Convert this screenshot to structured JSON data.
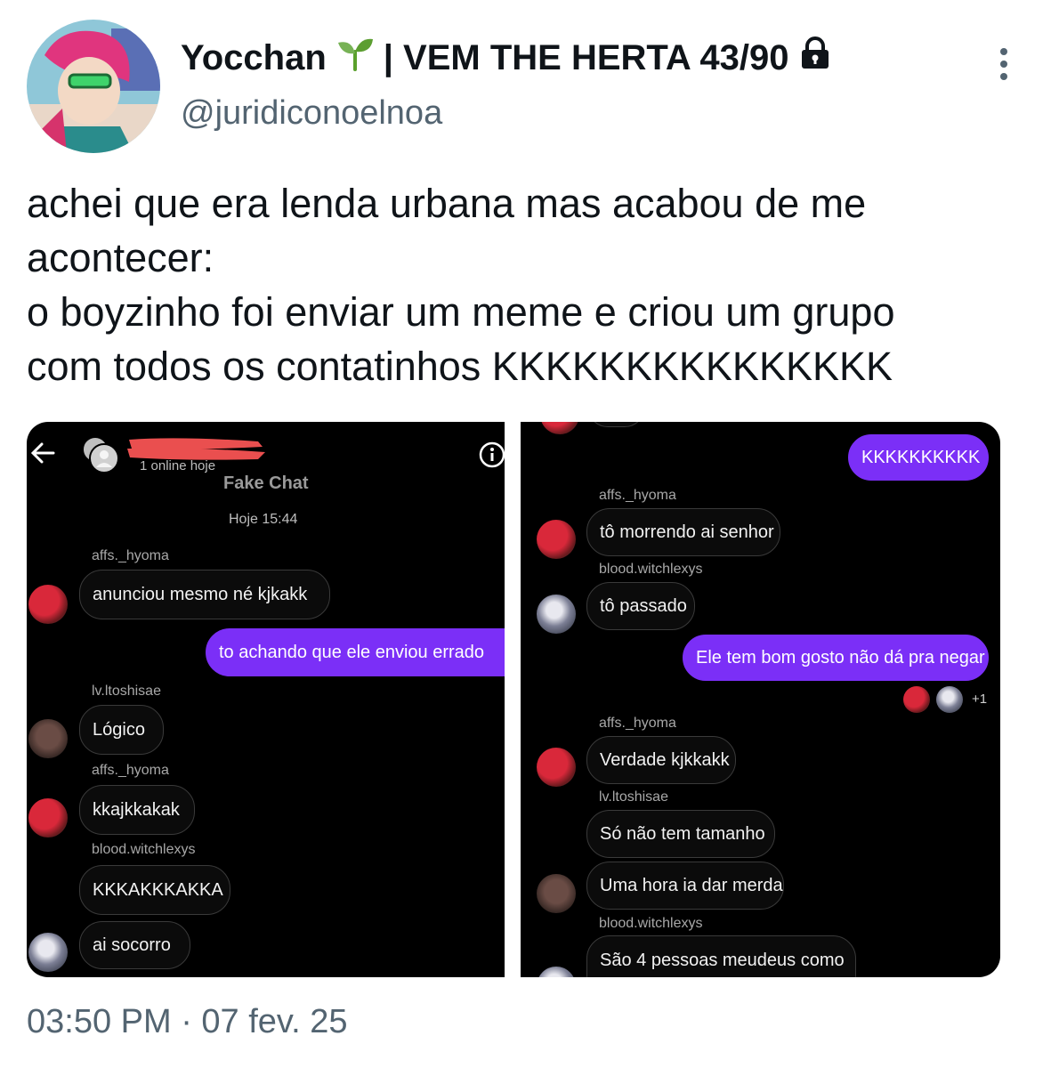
{
  "author": {
    "display_name": "Yocchan",
    "name_suffix": "| VEM THE HERTA 43/90",
    "handle": "@juridiconoelnoa",
    "icons": [
      "seedling-icon",
      "lock-icon"
    ]
  },
  "tweet": {
    "text": "achei que era lenda urbana mas acabou de me\nacontecer:\no boyzinho foi enviar um meme e criou um grupo\ncom todos os contatinhos KKKKKKKKKKKKKKK",
    "timestamp": "03:50 PM · 07 fev. 25"
  },
  "left_chat": {
    "online_status": "1 online hoje",
    "chat_name": "Fake Chat",
    "date": "Hoje 15:44",
    "messages": [
      {
        "sender": "affs._hyoma",
        "text": "anunciou mesmo né kjkakk"
      },
      {
        "sender": "",
        "text": "to achando que ele enviou errado",
        "sent": true
      },
      {
        "sender": "lv.ltoshisae",
        "text": "Lógico"
      },
      {
        "sender": "affs._hyoma",
        "text": "kkajkkakak"
      },
      {
        "sender": "blood.witchlexys",
        "text": "KKKAKKKAKKA"
      },
      {
        "sender": "",
        "text": "ai socorro"
      }
    ]
  },
  "right_chat": {
    "messages": [
      {
        "sender": "",
        "text": "KKKKKKKKKK",
        "sent": true
      },
      {
        "sender": "affs._hyoma",
        "text": "tô morrendo ai senhor"
      },
      {
        "sender": "blood.witchlexys",
        "text": "tô passado"
      },
      {
        "sender": "",
        "text": "Ele tem bom gosto não dá pra negar",
        "sent": true
      },
      {
        "sender": "affs._hyoma",
        "text": "Verdade kjkkakk"
      },
      {
        "sender": "lv.ltoshisae",
        "text": "Só não tem tamanho"
      },
      {
        "sender": "",
        "text": "Uma hora ia dar merda"
      },
      {
        "sender": "blood.witchlexys",
        "text": "São 4 pessoas meudeus como"
      }
    ],
    "seen_count": "+1"
  },
  "colors": {
    "sent_bubble": "#7b2ff7",
    "text_primary": "#0f1419",
    "text_secondary": "#536471"
  }
}
